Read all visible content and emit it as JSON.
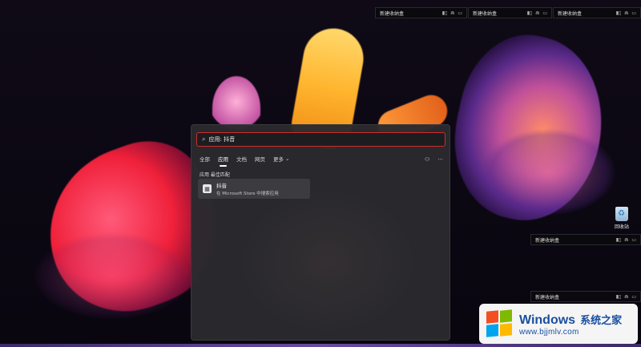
{
  "desktop": {
    "widgets": [
      {
        "label": "新建收纳盒",
        "controls": [
          "▮▯",
          "⋒",
          "▭",
          "✕"
        ]
      },
      {
        "label": "新建收纳盒",
        "controls": [
          "▮▯",
          "⋒",
          "▭",
          "✕"
        ]
      },
      {
        "label": "新建收纳盒",
        "controls": [
          "▮▯",
          "⋒",
          "▭",
          "✕"
        ]
      },
      {
        "label": "新建收纳盒",
        "controls": [
          "▮▯",
          "⋒",
          "▭",
          "✕"
        ]
      },
      {
        "label": "新建收纳盒",
        "controls": [
          "▮▯",
          "⋒",
          "▭",
          "✕"
        ]
      }
    ],
    "recycle_bin_label": "回收站"
  },
  "search": {
    "query": "应用: 抖音",
    "icon": "search-icon",
    "filters": {
      "all": "全部",
      "apps": "应用",
      "documents": "文档",
      "web": "网页",
      "more": "更多",
      "active": "apps"
    },
    "section_title": "应用 最佳匹配",
    "result": {
      "name": "抖音",
      "subtitle": "在 Microsoft Store 中搜索应用"
    }
  },
  "watermark": {
    "brand": "Windows",
    "cn": "系统之家",
    "url": "www.bjjmlv.com"
  },
  "colors": {
    "search_border": "#d22a2a",
    "panel_bg": "#2a2a2e",
    "watermark_text": "#1a4fa0"
  }
}
